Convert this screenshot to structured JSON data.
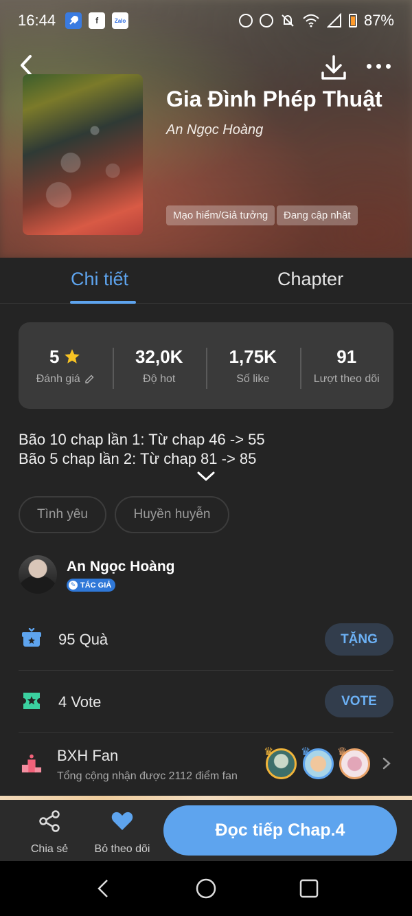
{
  "status_bar": {
    "time": "16:44",
    "battery": "87%",
    "apps": [
      "rocket-app-icon",
      "facebook-icon",
      "zalo-icon"
    ],
    "facebook_letter": "f",
    "zalo_label": "Zalo"
  },
  "book": {
    "title": "Gia Đình Phép Thuật",
    "author": "An Ngọc Hoàng",
    "tags": [
      "Mạo hiểm/Giả tưởng",
      "Đang cập nhật"
    ]
  },
  "tabs": [
    {
      "label": "Chi tiết",
      "active": true
    },
    {
      "label": "Chapter",
      "active": false
    }
  ],
  "stats": [
    {
      "value": "5",
      "label": "Đánh giá"
    },
    {
      "value": "32,0K",
      "label": "Độ hot"
    },
    {
      "value": "1,75K",
      "label": "Số like"
    },
    {
      "value": "91",
      "label": "Lượt theo dõi"
    }
  ],
  "description": [
    "Bão 10 chap lần 1: Từ chap 46 -> 55",
    "Bão 5 chap lần 2: Từ chap 81 -> 85"
  ],
  "genres": [
    "Tình yêu",
    "Huyền huyễn"
  ],
  "creator": {
    "name": "An Ngọc Hoàng",
    "badge": "TÁC GIẢ"
  },
  "gifts": {
    "label": "95 Quà",
    "button": "TẶNG"
  },
  "votes": {
    "label": "4 Vote",
    "button": "VOTE"
  },
  "fan_ranking": {
    "title": "BXH Fan",
    "subtitle": "Tổng cộng nhận được 2112 điểm fan"
  },
  "bottom_bar": {
    "share": "Chia sẻ",
    "unfollow": "Bỏ theo dõi",
    "read": "Đọc tiếp Chap.4"
  },
  "colors": {
    "accent": "#5ea4ee",
    "background": "#242424",
    "star": "#f7c324"
  }
}
